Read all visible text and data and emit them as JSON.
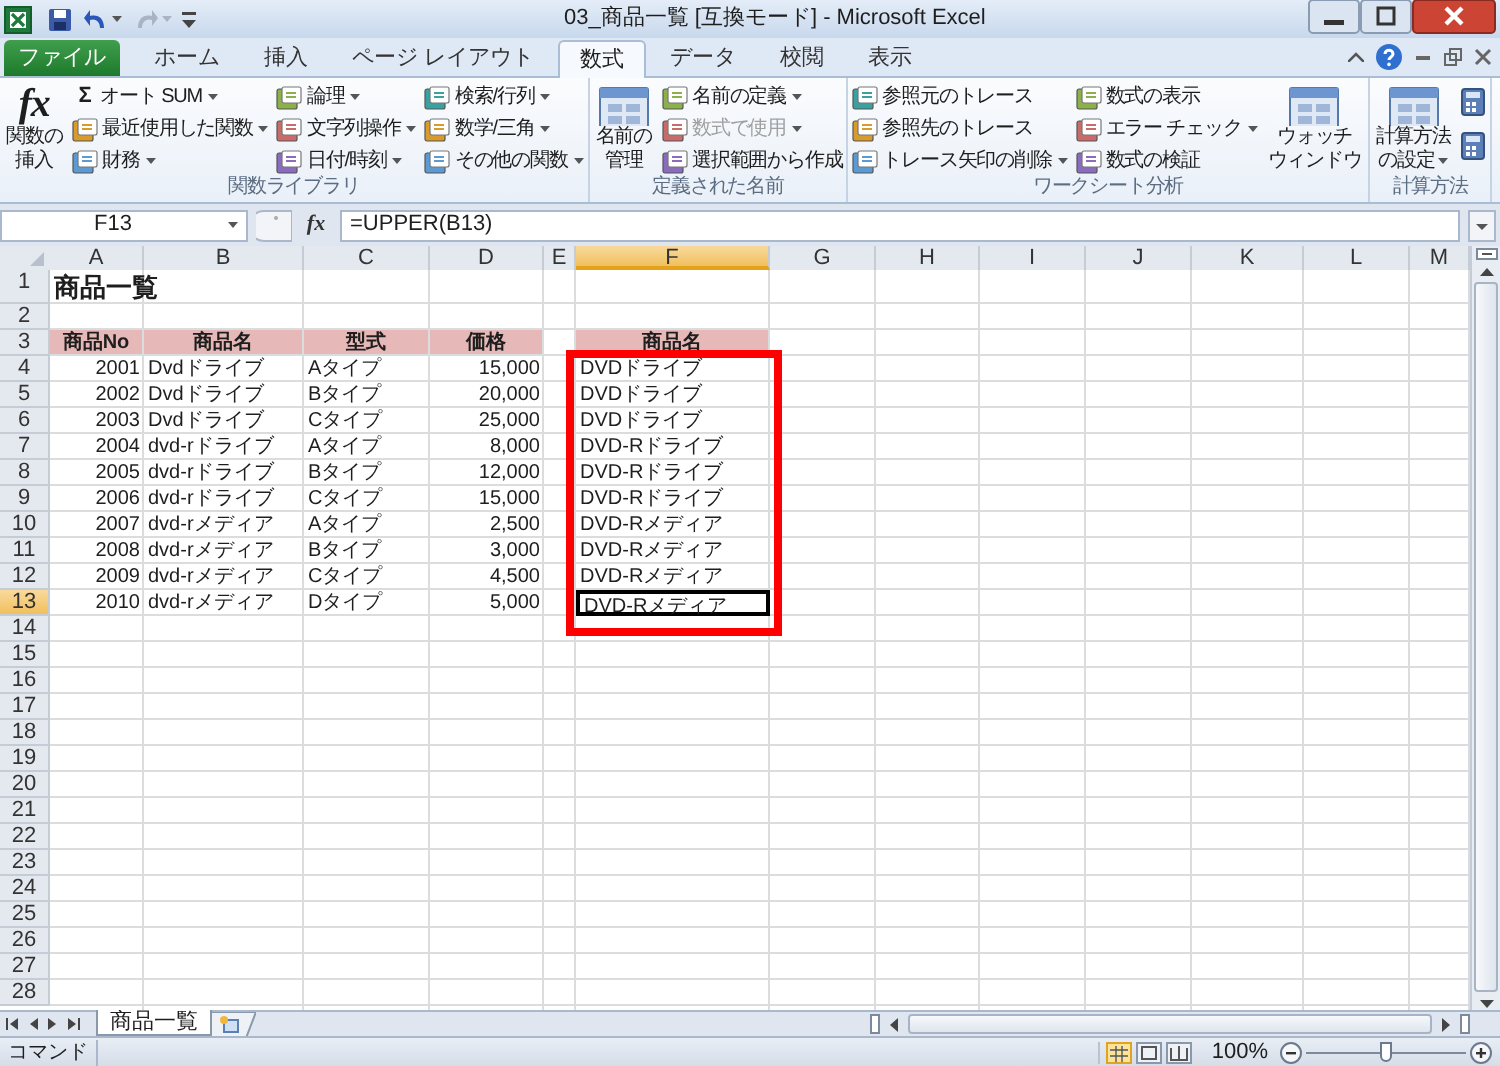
{
  "window": {
    "title": "03_商品一覧 [互換モード] - Microsoft Excel"
  },
  "ribbon_tabs": [
    {
      "label": "ファイル",
      "kind": "file",
      "selected": false
    },
    {
      "label": "ホーム",
      "kind": "tab",
      "selected": false
    },
    {
      "label": "挿入",
      "kind": "tab",
      "selected": false
    },
    {
      "label": "ページ レイアウト",
      "kind": "tab",
      "selected": false
    },
    {
      "label": "数式",
      "kind": "tab",
      "selected": true
    },
    {
      "label": "データ",
      "kind": "tab",
      "selected": false
    },
    {
      "label": "校閲",
      "kind": "tab",
      "selected": false
    },
    {
      "label": "表示",
      "kind": "tab",
      "selected": false
    }
  ],
  "ribbon_groups": [
    {
      "label": "関数ライブラリ",
      "columns": [
        [
          {
            "label": [
              "関数の",
              "挿入"
            ],
            "kind": "large",
            "icon_text": "fx",
            "dropdown": false,
            "disabled": false
          }
        ],
        [
          {
            "label": "オート SUM",
            "kind": "small",
            "icon_text": "Σ",
            "dropdown": true,
            "disabled": false
          },
          {
            "label": "最近使用した関数",
            "kind": "small",
            "dropdown": true,
            "disabled": false
          },
          {
            "label": "財務",
            "kind": "small",
            "dropdown": true,
            "disabled": false
          }
        ],
        [
          {
            "label": "論理",
            "kind": "small",
            "dropdown": true,
            "disabled": false
          },
          {
            "label": "文字列操作",
            "kind": "small",
            "dropdown": true,
            "disabled": false
          },
          {
            "label": "日付/時刻",
            "kind": "small",
            "dropdown": true,
            "disabled": false
          }
        ],
        [
          {
            "label": "検索/行列",
            "kind": "small",
            "dropdown": true,
            "disabled": false
          },
          {
            "label": "数学/三角",
            "kind": "small",
            "dropdown": true,
            "disabled": false
          },
          {
            "label": "その他の関数",
            "kind": "small",
            "dropdown": true,
            "disabled": false
          }
        ]
      ]
    },
    {
      "label": "定義された名前",
      "columns": [
        [
          {
            "label": [
              "名前の",
              "管理"
            ],
            "kind": "large",
            "dropdown": false,
            "disabled": false
          }
        ],
        [
          {
            "label": "名前の定義",
            "kind": "small",
            "dropdown": true,
            "disabled": false
          },
          {
            "label": "数式で使用",
            "kind": "small",
            "dropdown": true,
            "disabled": true
          },
          {
            "label": "選択範囲から作成",
            "kind": "small",
            "dropdown": false,
            "disabled": false
          }
        ]
      ]
    },
    {
      "label": "ワークシート分析",
      "columns": [
        [
          {
            "label": "参照元のトレース",
            "kind": "small",
            "dropdown": false,
            "disabled": false
          },
          {
            "label": "参照先のトレース",
            "kind": "small",
            "dropdown": false,
            "disabled": false
          },
          {
            "label": "トレース矢印の削除",
            "kind": "small",
            "dropdown": true,
            "disabled": false
          }
        ],
        [
          {
            "label": "数式の表示",
            "kind": "small",
            "dropdown": false,
            "disabled": false
          },
          {
            "label": "エラー チェック",
            "kind": "small",
            "dropdown": true,
            "disabled": false
          },
          {
            "label": "数式の検証",
            "kind": "small",
            "dropdown": false,
            "disabled": false
          }
        ],
        [
          {
            "label": [
              "ウォッチ",
              "ウィンドウ"
            ],
            "kind": "large",
            "dropdown": false,
            "disabled": false
          }
        ]
      ]
    },
    {
      "label": "計算方法",
      "columns": [
        [
          {
            "label": [
              "計算方法",
              "の設定"
            ],
            "kind": "large",
            "dropdown": true,
            "disabled": false
          }
        ],
        [
          {
            "kind": "icon"
          },
          {
            "kind": "icon"
          }
        ]
      ]
    }
  ],
  "formula_bar": {
    "name_box": "F13",
    "fx": "fx",
    "formula": "=UPPER(B13)"
  },
  "columns": [
    {
      "label": "A",
      "selected": false
    },
    {
      "label": "B",
      "selected": false
    },
    {
      "label": "C",
      "selected": false
    },
    {
      "label": "D",
      "selected": false
    },
    {
      "label": "E",
      "selected": false
    },
    {
      "label": "F",
      "selected": true
    },
    {
      "label": "G",
      "selected": false
    },
    {
      "label": "H",
      "selected": false
    },
    {
      "label": "I",
      "selected": false
    },
    {
      "label": "J",
      "selected": false
    },
    {
      "label": "K",
      "selected": false
    },
    {
      "label": "L",
      "selected": false
    },
    {
      "label": "M",
      "selected": false
    }
  ],
  "rows": [
    {
      "number": "1",
      "kind": "title",
      "selected": false,
      "cells": [
        {
          "text": "商品一覧",
          "kind": "text"
        }
      ]
    },
    {
      "number": "2",
      "kind": "data",
      "selected": false,
      "cells": []
    },
    {
      "number": "3",
      "kind": "header",
      "selected": false,
      "cells": [
        {
          "text": "商品No",
          "kind": "text"
        },
        {
          "text": "商品名",
          "kind": "text"
        },
        {
          "text": "型式",
          "kind": "text"
        },
        {
          "text": "価格",
          "kind": "text"
        },
        null,
        {
          "text": "商品名",
          "kind": "text"
        }
      ]
    },
    {
      "number": "4",
      "kind": "data",
      "selected": false,
      "cells": [
        {
          "text": "2001",
          "kind": "number"
        },
        {
          "text": "Dvdドライブ",
          "kind": "text"
        },
        {
          "text": "Aタイプ",
          "kind": "text"
        },
        {
          "text": "15,000",
          "kind": "number"
        },
        null,
        {
          "text": "DVDドライブ",
          "kind": "text"
        }
      ]
    },
    {
      "number": "5",
      "kind": "data",
      "selected": false,
      "cells": [
        {
          "text": "2002",
          "kind": "number"
        },
        {
          "text": "Dvdドライブ",
          "kind": "text"
        },
        {
          "text": "Bタイプ",
          "kind": "text"
        },
        {
          "text": "20,000",
          "kind": "number"
        },
        null,
        {
          "text": "DVDドライブ",
          "kind": "text"
        }
      ]
    },
    {
      "number": "6",
      "kind": "data",
      "selected": false,
      "cells": [
        {
          "text": "2003",
          "kind": "number"
        },
        {
          "text": "Dvdドライブ",
          "kind": "text"
        },
        {
          "text": "Cタイプ",
          "kind": "text"
        },
        {
          "text": "25,000",
          "kind": "number"
        },
        null,
        {
          "text": "DVDドライブ",
          "kind": "text"
        }
      ]
    },
    {
      "number": "7",
      "kind": "data",
      "selected": false,
      "cells": [
        {
          "text": "2004",
          "kind": "number"
        },
        {
          "text": "dvd-rドライブ",
          "kind": "text"
        },
        {
          "text": "Aタイプ",
          "kind": "text"
        },
        {
          "text": "8,000",
          "kind": "number"
        },
        null,
        {
          "text": "DVD-Rドライブ",
          "kind": "text"
        }
      ]
    },
    {
      "number": "8",
      "kind": "data",
      "selected": false,
      "cells": [
        {
          "text": "2005",
          "kind": "number"
        },
        {
          "text": "dvd-rドライブ",
          "kind": "text"
        },
        {
          "text": "Bタイプ",
          "kind": "text"
        },
        {
          "text": "12,000",
          "kind": "number"
        },
        null,
        {
          "text": "DVD-Rドライブ",
          "kind": "text"
        }
      ]
    },
    {
      "number": "9",
      "kind": "data",
      "selected": false,
      "cells": [
        {
          "text": "2006",
          "kind": "number"
        },
        {
          "text": "dvd-rドライブ",
          "kind": "text"
        },
        {
          "text": "Cタイプ",
          "kind": "text"
        },
        {
          "text": "15,000",
          "kind": "number"
        },
        null,
        {
          "text": "DVD-Rドライブ",
          "kind": "text"
        }
      ]
    },
    {
      "number": "10",
      "kind": "data",
      "selected": false,
      "cells": [
        {
          "text": "2007",
          "kind": "number"
        },
        {
          "text": "dvd-rメディア",
          "kind": "text"
        },
        {
          "text": "Aタイプ",
          "kind": "text"
        },
        {
          "text": "2,500",
          "kind": "number"
        },
        null,
        {
          "text": "DVD-Rメディア",
          "kind": "text"
        }
      ]
    },
    {
      "number": "11",
      "kind": "data",
      "selected": false,
      "cells": [
        {
          "text": "2008",
          "kind": "number"
        },
        {
          "text": "dvd-rメディア",
          "kind": "text"
        },
        {
          "text": "Bタイプ",
          "kind": "text"
        },
        {
          "text": "3,000",
          "kind": "number"
        },
        null,
        {
          "text": "DVD-Rメディア",
          "kind": "text"
        }
      ]
    },
    {
      "number": "12",
      "kind": "data",
      "selected": false,
      "cells": [
        {
          "text": "2009",
          "kind": "number"
        },
        {
          "text": "dvd-rメディア",
          "kind": "text"
        },
        {
          "text": "Cタイプ",
          "kind": "text"
        },
        {
          "text": "4,500",
          "kind": "number"
        },
        null,
        {
          "text": "DVD-Rメディア",
          "kind": "text"
        }
      ]
    },
    {
      "number": "13",
      "kind": "data",
      "selected": true,
      "cells": [
        {
          "text": "2010",
          "kind": "number"
        },
        {
          "text": "dvd-rメディア",
          "kind": "text"
        },
        {
          "text": "Dタイプ",
          "kind": "text"
        },
        {
          "text": "5,000",
          "kind": "number"
        },
        null,
        {
          "text": "DVD-Rメディア",
          "kind": "text"
        }
      ]
    },
    {
      "number": "14",
      "kind": "data",
      "selected": false,
      "cells": []
    },
    {
      "number": "15",
      "kind": "data",
      "selected": false,
      "cells": []
    },
    {
      "number": "16",
      "kind": "data",
      "selected": false,
      "cells": []
    },
    {
      "number": "17",
      "kind": "data",
      "selected": false,
      "cells": []
    },
    {
      "number": "18",
      "kind": "data",
      "selected": false,
      "cells": []
    },
    {
      "number": "19",
      "kind": "data",
      "selected": false,
      "cells": []
    },
    {
      "number": "20",
      "kind": "data",
      "selected": false,
      "cells": []
    },
    {
      "number": "21",
      "kind": "data",
      "selected": false,
      "cells": []
    },
    {
      "number": "22",
      "kind": "data",
      "selected": false,
      "cells": []
    },
    {
      "number": "23",
      "kind": "data",
      "selected": false,
      "cells": []
    },
    {
      "number": "24",
      "kind": "data",
      "selected": false,
      "cells": []
    },
    {
      "number": "25",
      "kind": "data",
      "selected": false,
      "cells": []
    },
    {
      "number": "26",
      "kind": "data",
      "selected": false,
      "cells": []
    },
    {
      "number": "27",
      "kind": "data",
      "selected": false,
      "cells": []
    },
    {
      "number": "28",
      "kind": "data",
      "selected": false,
      "cells": []
    }
  ],
  "highlight": {
    "kind": "frame",
    "color": "#ff0000"
  },
  "sheet_tabs": [
    {
      "label": "商品一覧",
      "selected": true
    }
  ],
  "status_bar": {
    "mode": "コマンド",
    "zoom": "100%",
    "zoom_slider": {
      "level": 0.5
    }
  }
}
